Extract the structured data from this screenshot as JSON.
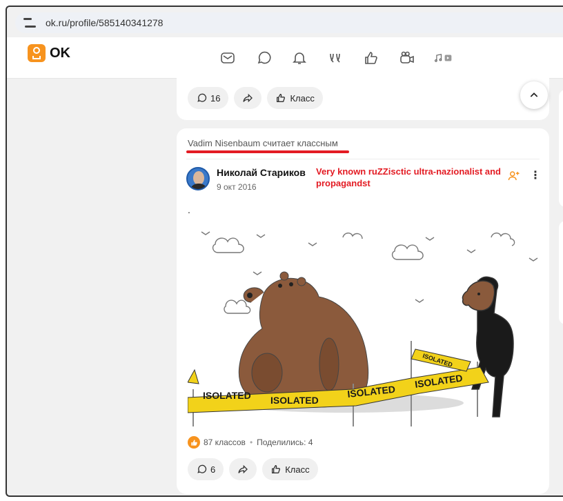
{
  "browser": {
    "url": "ok.ru/profile/585140341278"
  },
  "header": {
    "logo_text": "OK"
  },
  "nav_icons": [
    "mail-icon",
    "chat-icon",
    "bell-icon",
    "guests-icon",
    "like-icon",
    "video-icon",
    "music-icon",
    "media-icon"
  ],
  "prev_post": {
    "comments_count": "16",
    "like_label": "Класс"
  },
  "post": {
    "liked_by_text": "Vadim Nisenbaum считает классным",
    "author_name": "Николай Стариков",
    "date": "9 окт 2016",
    "annotation": "Very known ruZZisctic ultra-nazionalist and propagandst",
    "text": ".",
    "image_labels": [
      "ISOLATED",
      "ISOLATED",
      "ISOLATED",
      "ISOLATED",
      "ISOLATED"
    ],
    "likes_text": "87 классов",
    "shares_text": "Поделились: 4",
    "comments_count": "6",
    "like_label": "Класс"
  },
  "colors": {
    "brand": "#f7931e",
    "annotation": "#e31b23",
    "tape": "#f2d21a"
  }
}
